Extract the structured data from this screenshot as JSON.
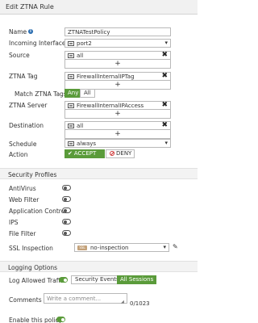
{
  "window": {
    "title": "Edit ZTNA Rule"
  },
  "form": {
    "name": {
      "label": "Name",
      "value": "ZTNATestPolicy"
    },
    "incoming_interface": {
      "label": "Incoming Interface",
      "value": "port2"
    },
    "source": {
      "label": "Source",
      "value": "all"
    },
    "ztna_tag": {
      "label": "ZTNA Tag",
      "value": "FirewallInternalIPTag"
    },
    "match_ztna_tags": {
      "label": "Match ZTNA Tags",
      "options": [
        "Any",
        "All"
      ],
      "selected": "Any"
    },
    "ztna_server": {
      "label": "ZTNA Server",
      "value": "FirewallInternalIPAccess"
    },
    "destination": {
      "label": "Destination",
      "value": "all"
    },
    "schedule": {
      "label": "Schedule",
      "value": "always"
    },
    "action": {
      "label": "Action",
      "accept_label": "ACCEPT",
      "deny_label": "DENY",
      "selected": "ACCEPT"
    },
    "plus_symbol": "+"
  },
  "security_profiles": {
    "title": "Security Profiles",
    "items": [
      {
        "label": "AntiVirus",
        "enabled": false
      },
      {
        "label": "Web Filter",
        "enabled": false
      },
      {
        "label": "Application Control",
        "enabled": false
      },
      {
        "label": "IPS",
        "enabled": false
      },
      {
        "label": "File Filter",
        "enabled": false
      }
    ],
    "ssl_inspection": {
      "label": "SSL Inspection",
      "badge": "SSL",
      "value": "no-inspection"
    }
  },
  "logging": {
    "title": "Logging Options",
    "log_allowed_traffic": {
      "label": "Log Allowed Traffic",
      "enabled": true,
      "options": [
        "Security Events",
        "All Sessions"
      ],
      "selected": "All Sessions"
    }
  },
  "comments": {
    "label": "Comments",
    "placeholder": "Write a comment...",
    "counter": "0/1023"
  },
  "enable_policy": {
    "label": "Enable this policy",
    "enabled": true
  },
  "colors": {
    "accent_green": "#5a9b3a",
    "deny_red": "#cc3333",
    "info_blue": "#2a6db0"
  }
}
